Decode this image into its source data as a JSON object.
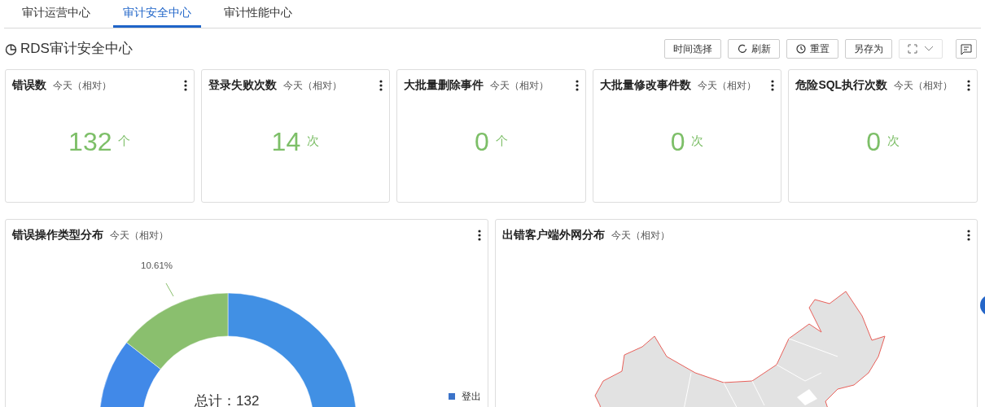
{
  "tabs": [
    {
      "label": "审计运营中心",
      "selected": false
    },
    {
      "label": "审计安全中心",
      "selected": true
    },
    {
      "label": "审计性能中心",
      "selected": false
    }
  ],
  "header": {
    "title": "RDS审计安全中心",
    "buttons": [
      {
        "kind": "text",
        "label": "时间选择"
      },
      {
        "kind": "refresh",
        "label": "刷新"
      },
      {
        "kind": "reset",
        "label": "重置"
      },
      {
        "kind": "text",
        "label": "另存为"
      },
      {
        "kind": "fullscreen"
      },
      {
        "kind": "note"
      }
    ]
  },
  "stats": [
    {
      "title": "错误数",
      "range": "今天（相对）",
      "value": "132",
      "unit": "个"
    },
    {
      "title": "登录失败次数",
      "range": "今天（相对）",
      "value": "14",
      "unit": "次"
    },
    {
      "title": "大批量删除事件",
      "range": "今天（相对）",
      "value": "0",
      "unit": "个"
    },
    {
      "title": "大批量修改事件数",
      "range": "今天（相对）",
      "value": "0",
      "unit": "次"
    },
    {
      "title": "危险SQL执行次数",
      "range": "今天（相对）",
      "value": "0",
      "unit": "次"
    }
  ],
  "donut_panel": {
    "title": "错误操作类型分布",
    "range": "今天（相对）",
    "slice_label": "10.61%",
    "total": "总计：132",
    "legend": [
      {
        "label": "登出",
        "color": "#3b73c9"
      }
    ]
  },
  "map_panel": {
    "title": "出错客户端外网分布",
    "range": "今天（相对）"
  }
}
